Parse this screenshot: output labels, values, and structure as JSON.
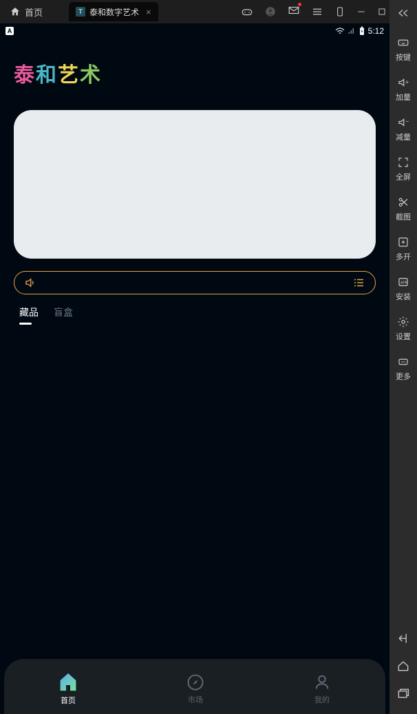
{
  "browser": {
    "home_label": "首页",
    "tab_title": "泰和数字艺术"
  },
  "sidebar": {
    "tools": [
      {
        "label": "按键",
        "icon": "keyboard-icon"
      },
      {
        "label": "加量",
        "icon": "volume-up-icon"
      },
      {
        "label": "减量",
        "icon": "volume-down-icon"
      },
      {
        "label": "全屏",
        "icon": "fullscreen-icon"
      },
      {
        "label": "截图",
        "icon": "scissors-icon"
      },
      {
        "label": "多开",
        "icon": "multi-window-icon"
      },
      {
        "label": "安装",
        "icon": "apk-icon"
      },
      {
        "label": "设置",
        "icon": "settings-icon"
      },
      {
        "label": "更多",
        "icon": "more-icon"
      }
    ]
  },
  "status": {
    "time": "5:12"
  },
  "app": {
    "logo_text": "泰和艺术"
  },
  "content_tabs": [
    {
      "label": "藏品",
      "active": true
    },
    {
      "label": "盲盒",
      "active": false
    }
  ],
  "bottom_nav": [
    {
      "label": "首页",
      "icon": "home-icon",
      "active": true
    },
    {
      "label": "市场",
      "icon": "compass-icon",
      "active": false
    },
    {
      "label": "我的",
      "icon": "user-icon",
      "active": false
    }
  ]
}
